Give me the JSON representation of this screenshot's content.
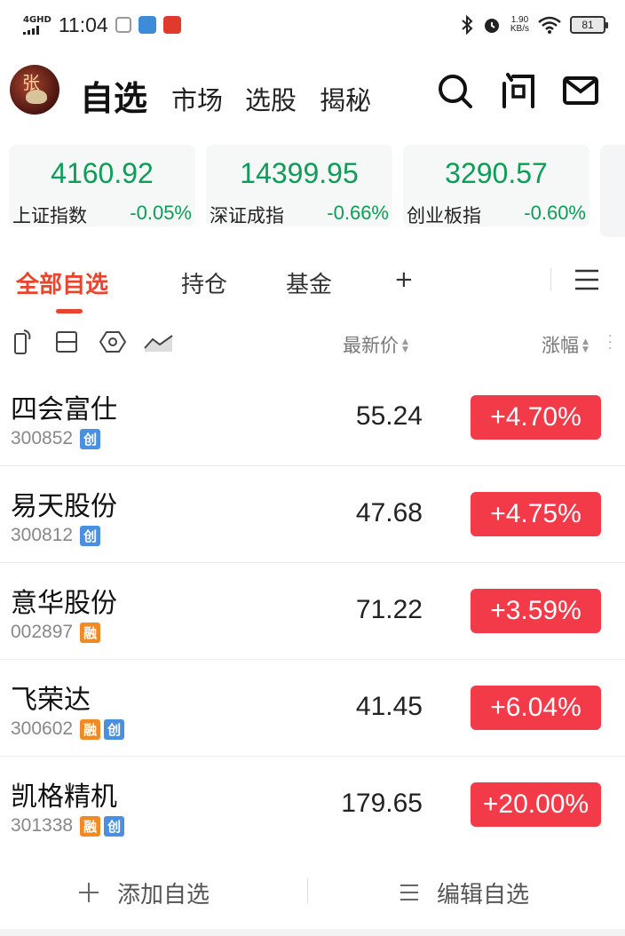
{
  "status_bar": {
    "network": "4GHD",
    "time": "11:04",
    "speed_value": "1.90",
    "speed_unit": "KB/s",
    "battery": "81",
    "icons": [
      "signal-icon",
      "screenshot-icon",
      "app-icon",
      "notification-icon",
      "bluetooth-icon",
      "alarm-icon",
      "wifi-icon",
      "battery-icon"
    ]
  },
  "header": {
    "avatar_text": "张",
    "tabs": [
      "自选",
      "市场",
      "选股",
      "揭秘"
    ],
    "active_tab": "自选",
    "icons": [
      "search-icon",
      "ask-icon",
      "mail-icon"
    ]
  },
  "indices": [
    {
      "name": "上证指数",
      "value": "4160.92",
      "change": "-0.05%"
    },
    {
      "name": "深证成指",
      "value": "14399.95",
      "change": "-0.66%"
    },
    {
      "name": "创业板指",
      "value": "3290.57",
      "change": "-0.60%"
    }
  ],
  "watch_tabs": [
    "全部自选",
    "持仓",
    "基金",
    "+"
  ],
  "columns": {
    "price": "最新价",
    "change": "涨幅"
  },
  "stocks": [
    {
      "name": "四会富仕",
      "code": "300852",
      "tags": [
        "创"
      ],
      "price": "55.24",
      "change": "+4.70%"
    },
    {
      "name": "易天股份",
      "code": "300812",
      "tags": [
        "创"
      ],
      "price": "47.68",
      "change": "+4.75%"
    },
    {
      "name": "意华股份",
      "code": "002897",
      "tags": [
        "融"
      ],
      "price": "71.22",
      "change": "+3.59%"
    },
    {
      "name": "飞荣达",
      "code": "300602",
      "tags": [
        "融",
        "创"
      ],
      "price": "41.45",
      "change": "+6.04%"
    },
    {
      "name": "凯格精机",
      "code": "301338",
      "tags": [
        "融",
        "创"
      ],
      "price": "179.65",
      "change": "+20.00%"
    }
  ],
  "footer": {
    "add_label": "添加自选",
    "edit_label": "编辑自选"
  },
  "colors": {
    "up": "#f23a49",
    "down": "#0e9d58",
    "accent": "#e8452d",
    "tag_chuang": "#4a90e2",
    "tag_rong": "#f08a24"
  }
}
